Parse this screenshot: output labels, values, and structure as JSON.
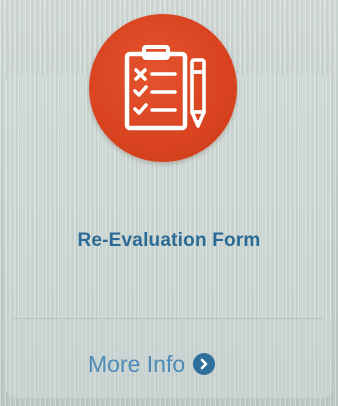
{
  "tile": {
    "icon": "clipboard-checklist-pencil-icon",
    "title": "Re-Evaluation Form",
    "more_info_label": "More Info",
    "more_info_icon": "chevron-right-circle-icon"
  },
  "colors": {
    "icon_circle": "#d9431f",
    "title_text": "#2c6b95",
    "link_text": "#4d8bb8",
    "chevron_badge": "#2f6f9c",
    "background": "#c9d3d0"
  }
}
